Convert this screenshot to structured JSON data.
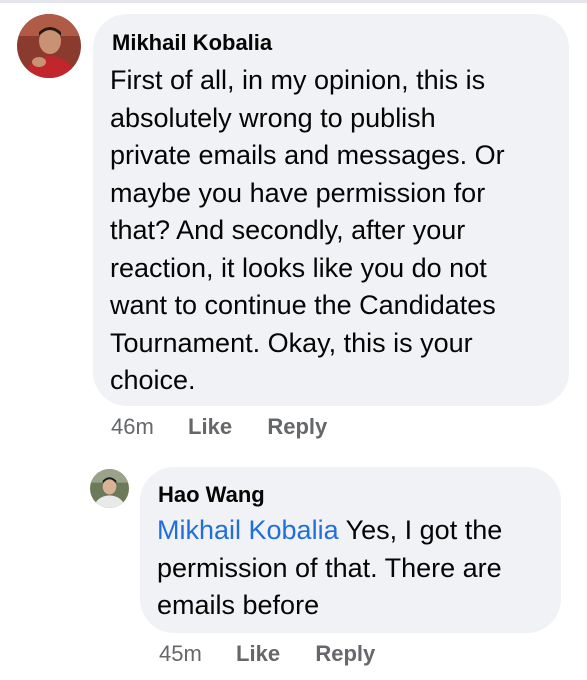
{
  "comments": [
    {
      "author": "Mikhail Kobalia",
      "text": "First of all, in my opinion, this is\nabsolutely wrong to publish\nprivate emails and messages. Or\nmaybe you have permission for\nthat? And secondly, after your\nreaction, it looks like you do not\nwant to continue the Candidates\nTournament. Okay, this is your\nchoice.",
      "time": "46m",
      "like_label": "Like",
      "reply_label": "Reply"
    },
    {
      "author": "Hao Wang",
      "mention": "Mikhail Kobalia",
      "text": " Yes, I got the\npermission of that. There are\nemails before",
      "time": "45m",
      "like_label": "Like",
      "reply_label": "Reply"
    }
  ],
  "colors": {
    "bubble": "#f0f2f5",
    "mention": "#216fdb",
    "meta": "#65676b"
  },
  "icons": {
    "avatar_1": "user-photo-avatar",
    "avatar_2": "user-photo-avatar"
  }
}
